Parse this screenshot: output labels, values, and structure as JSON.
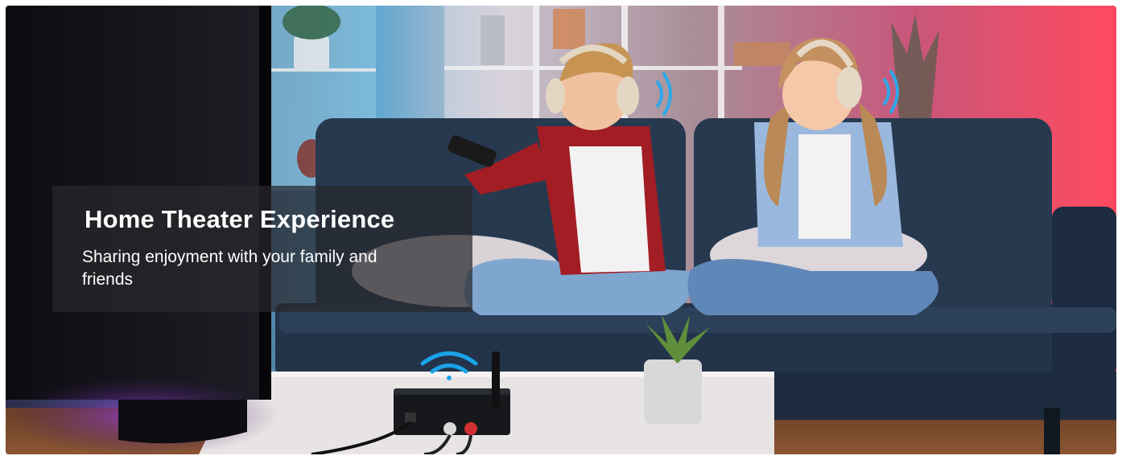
{
  "banner": {
    "title": "Home Theater Experience",
    "subtitle": "Sharing enjoyment with your family and friends"
  },
  "palette": {
    "sofa": "#24354c",
    "wall_pink": "#e0567a",
    "wall_blue": "#6fb8d8",
    "floor": "#7a4a2e",
    "wireless_icon": "#1aa3e8"
  },
  "icons": [
    "wireless-signal-icon"
  ]
}
